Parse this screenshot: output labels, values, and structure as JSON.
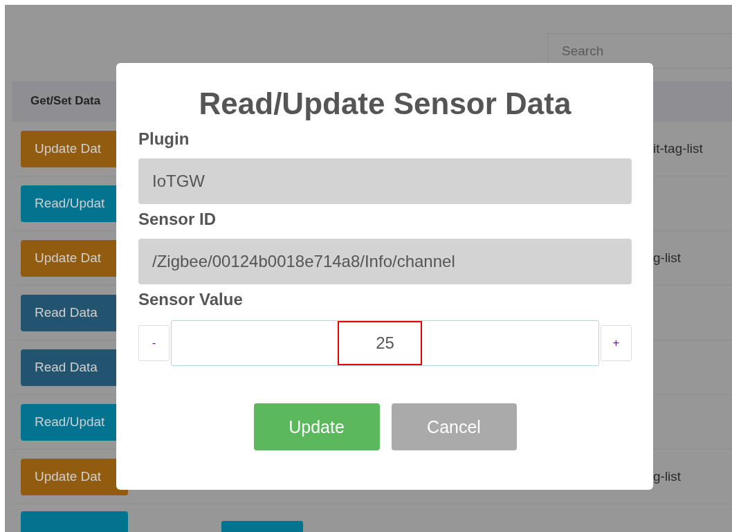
{
  "search": {
    "placeholder": "Search"
  },
  "table": {
    "header": "Get/Set Data",
    "rows": [
      {
        "button": {
          "label": "Update Dat",
          "kind": "update"
        },
        "tail": "it-tag-list"
      },
      {
        "button": {
          "label": "Read/Updat",
          "kind": "readupdate"
        }
      },
      {
        "button": {
          "label": "Update Dat",
          "kind": "update"
        },
        "tail": "g-list"
      },
      {
        "button": {
          "label": "Read Data",
          "kind": "read"
        }
      },
      {
        "button": {
          "label": "Read Data",
          "kind": "read"
        }
      },
      {
        "button": {
          "label": "Read/Updat",
          "kind": "readupdate"
        }
      },
      {
        "button": {
          "label": "Update Dat",
          "kind": "update"
        },
        "tail": "g-list"
      },
      {
        "button": {
          "kind": "readupdate"
        },
        "badge": {
          "kind": "readwrite"
        }
      }
    ]
  },
  "modal": {
    "title": "Read/Update Sensor Data",
    "plugin": {
      "label": "Plugin",
      "value": "IoTGW"
    },
    "sensor_id": {
      "label": "Sensor ID",
      "value": "/Zigbee/00124b0018e714a8/Info/channel"
    },
    "sensor_value": {
      "label": "Sensor Value",
      "value": "25",
      "decrement": "-",
      "increment": "+"
    },
    "buttons": [
      {
        "label": "Update",
        "kind": "primary"
      },
      {
        "label": "Cancel",
        "kind": "secondary"
      }
    ]
  }
}
